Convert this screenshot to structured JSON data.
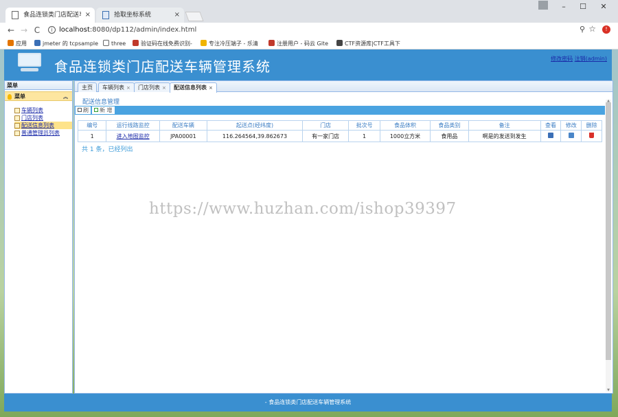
{
  "browser": {
    "tabs": [
      {
        "title": "食品连锁类门店配送车辆",
        "close": "×"
      },
      {
        "title": "拾取坐标系统",
        "close": "×"
      }
    ],
    "window_controls": {
      "minimize": "–",
      "maximize": "☐",
      "close": "✕"
    },
    "nav": {
      "back": "←",
      "forward": "→",
      "reload": "C"
    },
    "url_host": "localhost",
    "url_rest": ":8080/dp112/admin/index.html",
    "bookmarks": [
      {
        "label": "应用",
        "color": "#e37400"
      },
      {
        "label": "jmeter 的 tcpsample",
        "color": "#3b6fb6"
      },
      {
        "label": "three",
        "color": "#ffffff"
      },
      {
        "label": "验证码在线免费识别-",
        "color": "#c0392b"
      },
      {
        "label": "专注冷压端子 - 乐清",
        "color": "#f0b400"
      },
      {
        "label": "注册用户 - 码云 Gite",
        "color": "#c0392b"
      },
      {
        "label": "CTF资源库|CTF工具下",
        "color": "#444444"
      }
    ]
  },
  "header": {
    "title": "食品连锁类门店配送车辆管理系统",
    "change_password": "修改密码",
    "logout": "注销(admin)"
  },
  "sidebar": {
    "title": "菜单",
    "menu_title": "菜单",
    "items": [
      {
        "label": "车辆列表"
      },
      {
        "label": "门店列表"
      },
      {
        "label": "配送信息列表"
      },
      {
        "label": "普通管理员列表"
      }
    ]
  },
  "content_tabs": [
    {
      "label": "主页"
    },
    {
      "label": "车辆列表",
      "close": "×"
    },
    {
      "label": "门店列表",
      "close": "×"
    },
    {
      "label": "配送信息列表",
      "close": "×"
    }
  ],
  "panel": {
    "title": "配送信息管理",
    "toolbar": {
      "refresh": "刷",
      "add": "新 增"
    }
  },
  "table": {
    "columns": [
      "编号",
      "运行线路监控",
      "配送车辆",
      "起送点(经纬度)",
      "门店",
      "批次号",
      "食品体积",
      "食品类别",
      "备注",
      "查看",
      "修改",
      "删除"
    ],
    "rows": [
      {
        "id": "1",
        "route_monitor": "进入地图监控",
        "vehicle": "JPA00001",
        "start_point": "116.264564,39.862673",
        "store": "有一家门店",
        "batch": "1",
        "volume": "1000立方米",
        "category": "食用品",
        "remark": "啊是的发送到发生"
      }
    ]
  },
  "pager": {
    "text": "共 1 条，已经列出"
  },
  "watermark": "https://www.huzhan.com/ishop39397",
  "footer": {
    "text": "- 食品连锁类门店配送车辆管理系统"
  },
  "colors": {
    "header_blue": "#3a8fd0",
    "link": "#1a2aa8",
    "menu_selected": "#fde38b"
  }
}
